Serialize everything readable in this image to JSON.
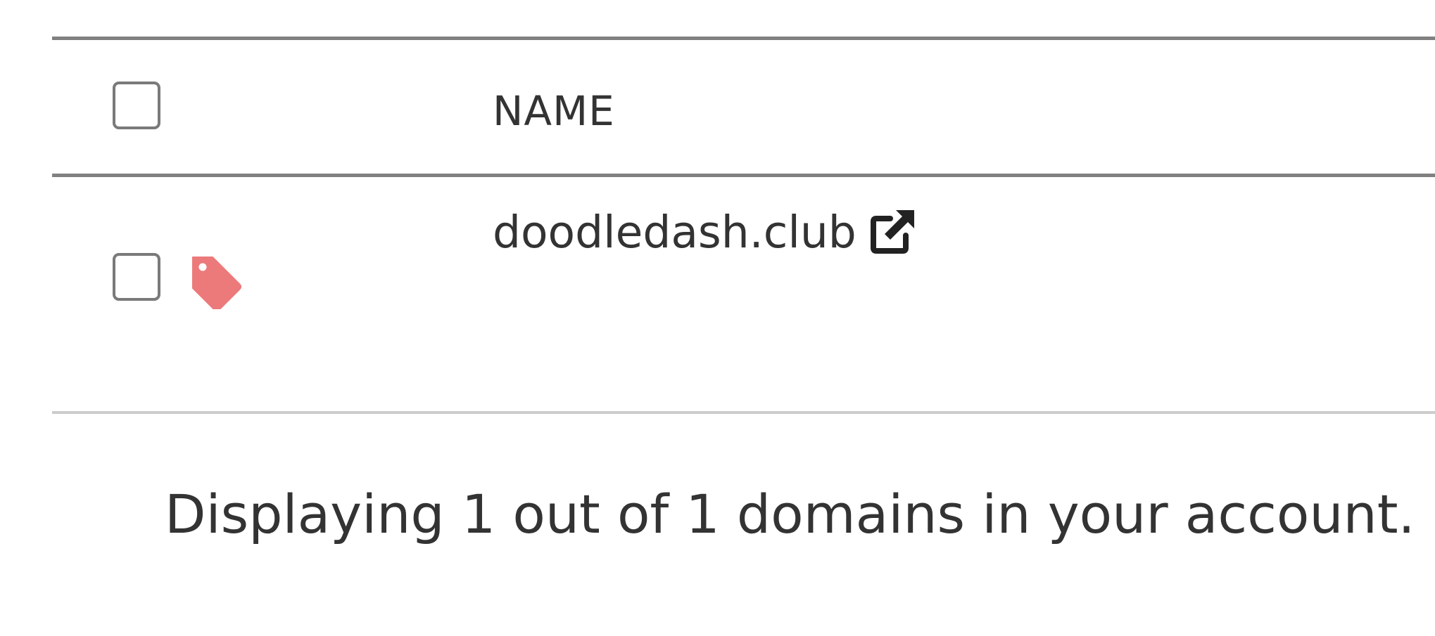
{
  "table": {
    "header": {
      "select_all_checked": false,
      "columns": [
        {
          "label": "NAME"
        }
      ]
    },
    "rows": [
      {
        "checked": false,
        "tag_icon": "tag-icon",
        "tag_color": "#ec7a7a",
        "name": "doodledash.club",
        "link_icon": "external-link-icon"
      }
    ]
  },
  "footer": {
    "summary": "Displaying 1 out of 1 domains in your account."
  }
}
